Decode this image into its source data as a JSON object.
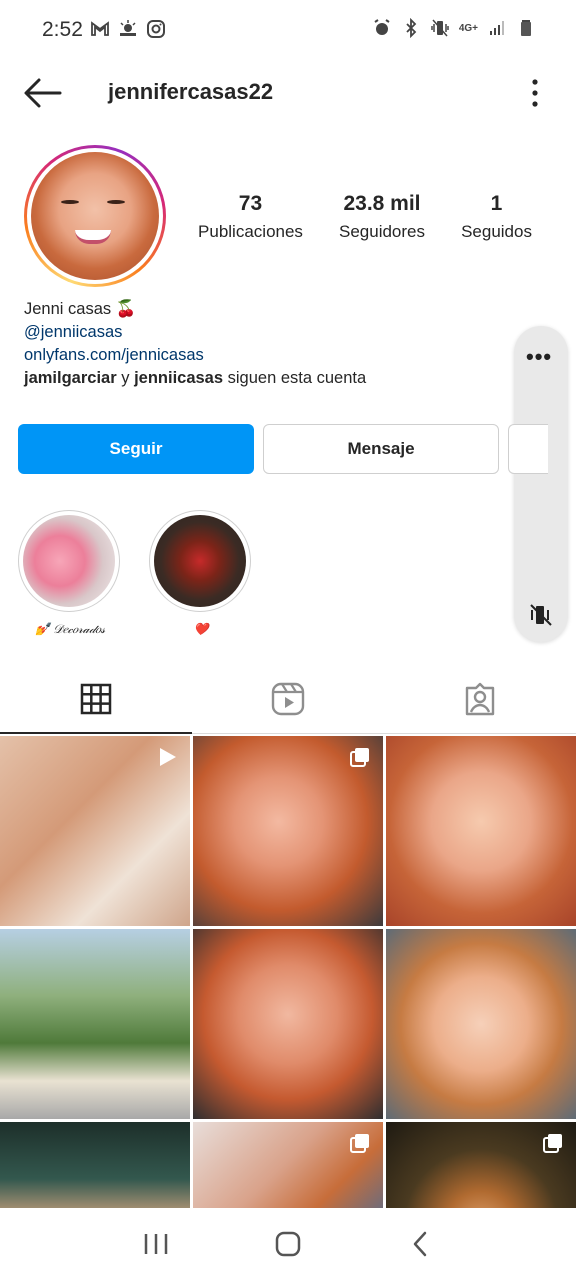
{
  "status_bar": {
    "time": "2:52",
    "left_icons": [
      "gmail-icon",
      "weather-icon",
      "instagram-icon"
    ],
    "right_icons": [
      "alarm-icon",
      "bluetooth-icon",
      "vibrate-icon",
      "network-4g-icon",
      "signal-icon",
      "battery-icon"
    ],
    "network_label": "4G+"
  },
  "header": {
    "username": "jennifercasas22"
  },
  "profile": {
    "stats": [
      {
        "value": "73",
        "label": "Publicaciones"
      },
      {
        "value": "23.8 mil",
        "label": "Seguidores"
      },
      {
        "value": "1",
        "label": "Seguidos"
      }
    ],
    "name": "Jenni casas 🍒",
    "handle": "@jenniicasas",
    "link": "onlyfans.com/jennicasas",
    "followed_by_1": "jamilgarciar",
    "followed_by_conj": " y ",
    "followed_by_2": "jenniicasas",
    "followed_by_suffix": " siguen esta cuenta"
  },
  "buttons": {
    "follow": "Seguir",
    "message": "Mensaje"
  },
  "highlights": [
    {
      "label": "💅 𝒟𝑒𝒸𝑜𝓇𝒶𝒹𝑜𝓈"
    },
    {
      "label": "❤️"
    }
  ],
  "tabs": [
    "grid-icon",
    "reels-icon",
    "tagged-icon"
  ],
  "grid_badges": [
    "reel",
    "multi",
    "none",
    "none",
    "none",
    "none",
    "none",
    "multi",
    "multi"
  ],
  "colors": {
    "accent": "#0095f6",
    "link": "#00376b",
    "text": "#262626"
  }
}
